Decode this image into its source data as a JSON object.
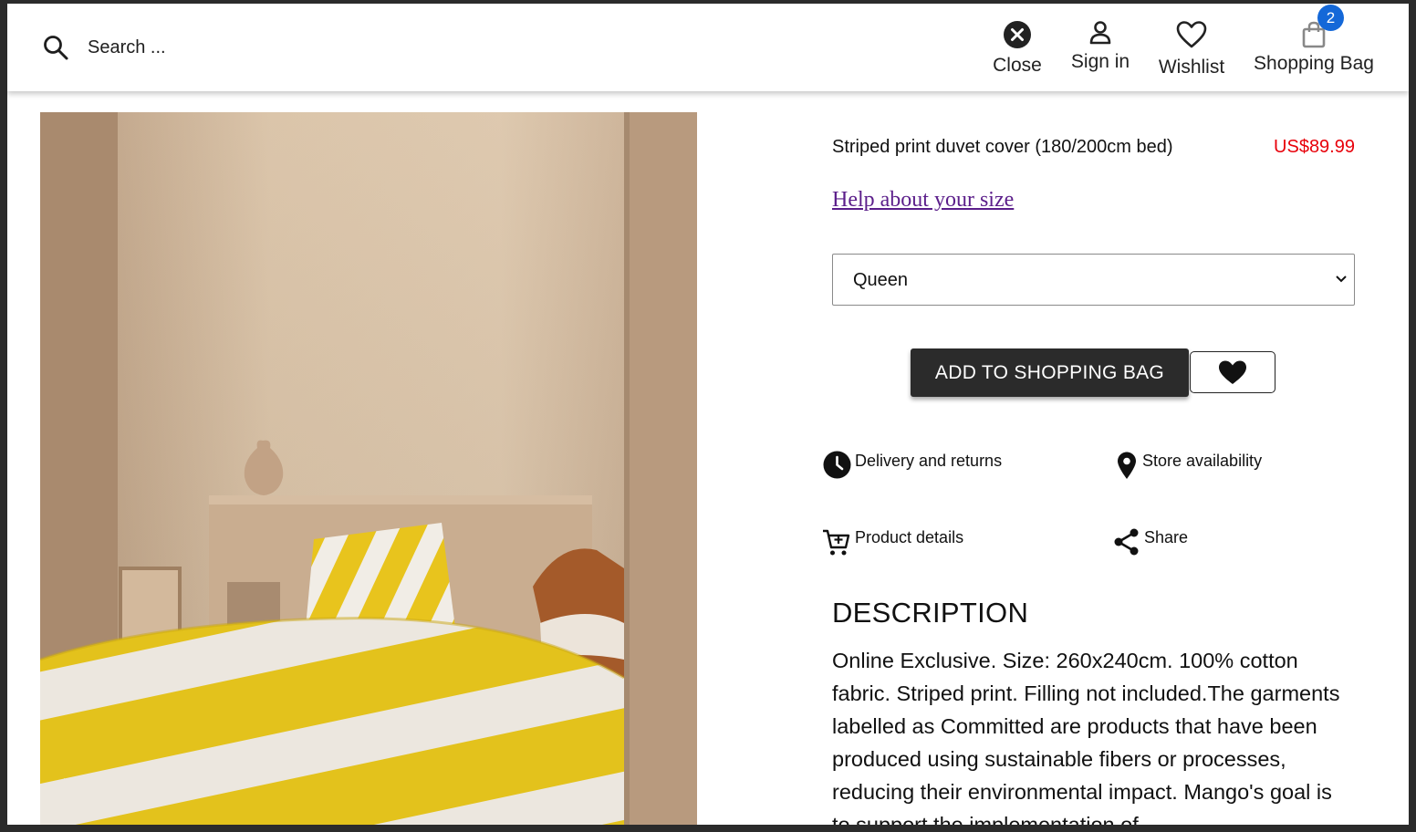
{
  "search": {
    "placeholder": "Search ..."
  },
  "header": {
    "close_label": "Close",
    "signin_label": "Sign in",
    "wishlist_label": "Wishlist",
    "bag_label": "Shopping Bag",
    "bag_count": "2"
  },
  "product": {
    "title": "Striped print duvet cover (180/200cm bed)",
    "price": "US$89.99",
    "size_help": "Help about your size",
    "size_selected": "Queen",
    "add_label": "ADD TO SHOPPING BAG"
  },
  "info": {
    "delivery": "Delivery and returns",
    "store": "Store availability",
    "details": "Product details",
    "share": "Share"
  },
  "description": {
    "heading": "DESCRIPTION",
    "body": "Online Exclusive. Size: 260x240cm. 100% cotton fabric. Striped print. Filling not included.The garments labelled as Committed are products that have been produced using sustainable fibers or processes, reducing their environmental impact. Mango's goal is to support the implementation of"
  },
  "colors": {
    "price": "#e8000a",
    "badge": "#1468d8",
    "button": "#2b2b2b",
    "link": "#5b1e8a"
  }
}
